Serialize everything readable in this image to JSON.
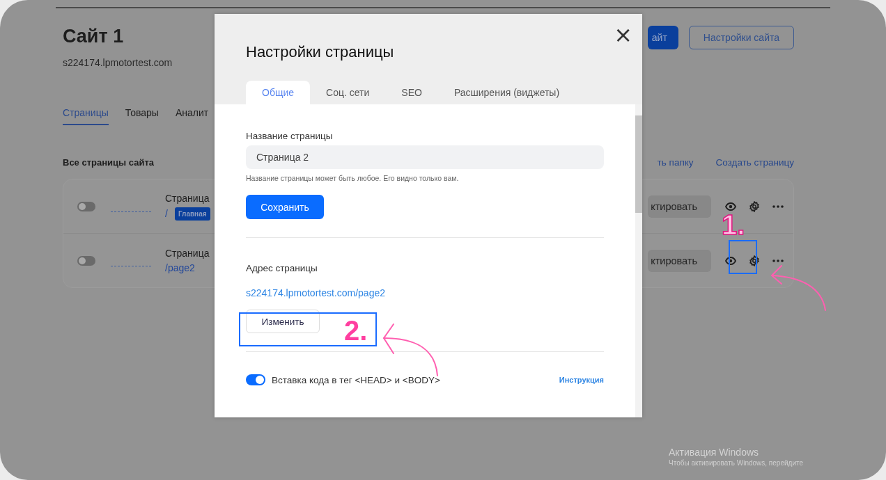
{
  "site": {
    "title": "Сайт 1",
    "domain": "s224174.lpmotortest.com",
    "buttons": [
      {
        "label": "айт",
        "kind": "primary"
      },
      {
        "label": "Настройки сайта",
        "kind": "outline"
      }
    ]
  },
  "tabs": [
    {
      "label": "Страницы",
      "selected": true
    },
    {
      "label": "Товары",
      "selected": false
    },
    {
      "label": "Аналит",
      "selected": false
    }
  ],
  "section": {
    "title": "Все страницы сайта",
    "actions": [
      "ть папку",
      "Создать страницу"
    ]
  },
  "pages": [
    {
      "name": "Страница",
      "path": "/",
      "badge": "Главная",
      "on": false,
      "action": "ктировать"
    },
    {
      "name": "Страница",
      "path": "/page2",
      "on": false,
      "action": "ктировать"
    }
  ],
  "modal": {
    "title": "Настройки страницы",
    "close": "×",
    "tabs": [
      {
        "label": "Общие",
        "selected": true
      },
      {
        "label": "Соц. сети",
        "selected": false
      },
      {
        "label": "SEO",
        "selected": false
      },
      {
        "label": "Расширения (виджеты)",
        "selected": false
      }
    ],
    "name_label": "Название страницы",
    "name_value": "Страница 2",
    "name_hint": "Название страницы может быть любое. Его видно только вам.",
    "save": "Сохранить",
    "address_label": "Адрес страницы",
    "address": "s224174.lpmotortest.com/page2",
    "change": "Изменить",
    "code_toggle": {
      "label": "Вставка кода в тег <HEAD> и <BODY>",
      "on": true,
      "link": "Инструкция"
    }
  },
  "annotations": [
    {
      "label": "1."
    },
    {
      "label": "2."
    }
  ],
  "os_notice": {
    "title": "Активация Windows",
    "text": "Чтобы активировать Windows, перейдите"
  }
}
